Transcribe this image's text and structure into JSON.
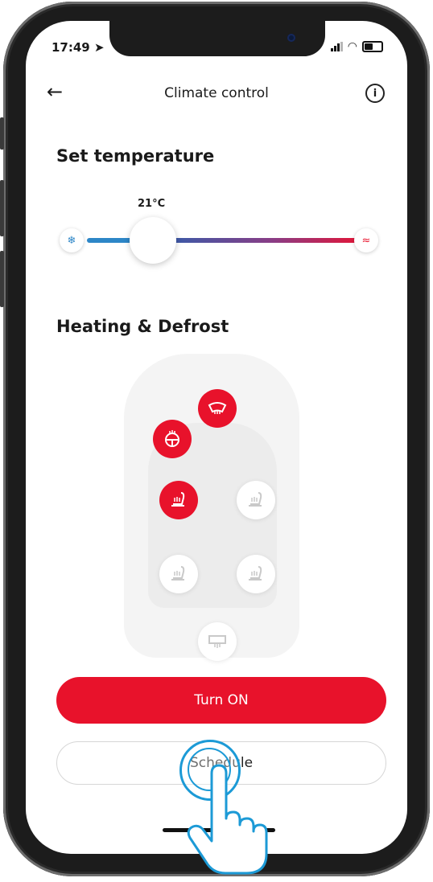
{
  "status_bar": {
    "time": "17:49"
  },
  "header": {
    "title": "Climate control"
  },
  "temperature": {
    "section_title": "Set temperature",
    "value_label": "21°C"
  },
  "heating": {
    "section_title": "Heating & Defrost",
    "buttons": [
      {
        "id": "front-defrost",
        "state": "on"
      },
      {
        "id": "steering-wheel-heat",
        "state": "on"
      },
      {
        "id": "driver-seat-heat",
        "state": "on"
      },
      {
        "id": "passenger-seat-heat",
        "state": "off"
      },
      {
        "id": "rear-left-seat-heat",
        "state": "off"
      },
      {
        "id": "rear-right-seat-heat",
        "state": "off"
      },
      {
        "id": "rear-defrost",
        "state": "off"
      }
    ]
  },
  "actions": {
    "turn_on_label": "Turn ON",
    "schedule_label": "Schedule"
  },
  "colors": {
    "accent": "#e8122b",
    "cold": "#2d86c7",
    "tap_indicator": "#1c9ad6"
  }
}
